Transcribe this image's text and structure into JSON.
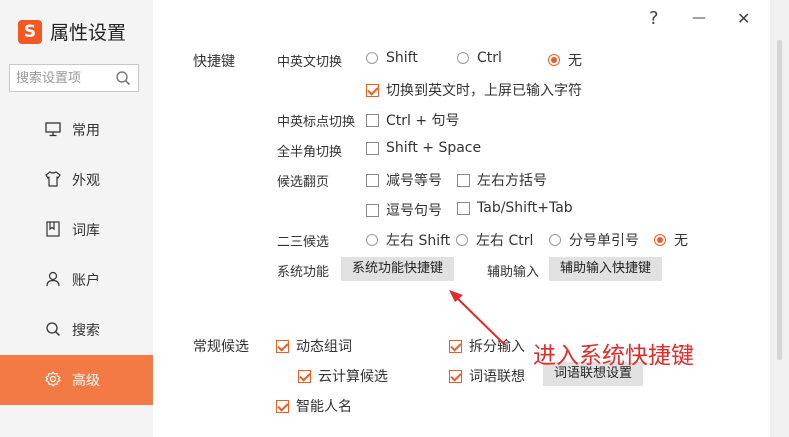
{
  "app": {
    "logo_letter": "S",
    "title": "属性设置"
  },
  "search": {
    "placeholder": "搜索设置项"
  },
  "nav": [
    {
      "label": "常用",
      "icon": "monitor-icon"
    },
    {
      "label": "外观",
      "icon": "shirt-icon"
    },
    {
      "label": "词库",
      "icon": "book-icon"
    },
    {
      "label": "账户",
      "icon": "user-icon"
    },
    {
      "label": "搜索",
      "icon": "search-icon"
    },
    {
      "label": "高级",
      "icon": "gear-icon",
      "active": true
    }
  ],
  "window": {
    "help": "?",
    "minimize": "—",
    "close": "✕"
  },
  "shortcuts": {
    "section": "快捷键",
    "cn_en": {
      "label": "中英文切换",
      "opt1": "Shift",
      "opt2": "Ctrl",
      "opt3": "无",
      "selected": "无",
      "commit_label": "切换到英文时，上屏已输入字符",
      "commit_checked": true
    },
    "punct": {
      "label": "中英标点切换",
      "opt": "Ctrl + 句号",
      "checked": false
    },
    "width": {
      "label": "全半角切换",
      "opt": "Shift + Space",
      "checked": false
    },
    "page": {
      "label": "候选翻页",
      "opt1": "减号等号",
      "opt2": "左右方括号",
      "opt3": "逗号句号",
      "opt4": "Tab/Shift+Tab"
    },
    "second": {
      "label": "二三候选",
      "opt1": "左右 Shift",
      "opt2": "左右 Ctrl",
      "opt3": "分号单引号",
      "opt4": "无",
      "selected": "无"
    },
    "system": {
      "label": "系统功能",
      "button": "系统功能快捷键"
    },
    "assist": {
      "label": "辅助输入",
      "button": "辅助输入快捷键"
    }
  },
  "candidates": {
    "section": "常规候选",
    "dynamic": "动态组词",
    "cloud": "云计算候选",
    "names": "智能人名",
    "split": "拆分输入",
    "assoc": "词语联想",
    "assoc_button": "词语联想设置"
  },
  "annotation": {
    "text": "进入系统快捷键",
    "color": "#e52a2a"
  },
  "colors": {
    "accent": "#f25a22",
    "active_nav": "#f47a45"
  }
}
